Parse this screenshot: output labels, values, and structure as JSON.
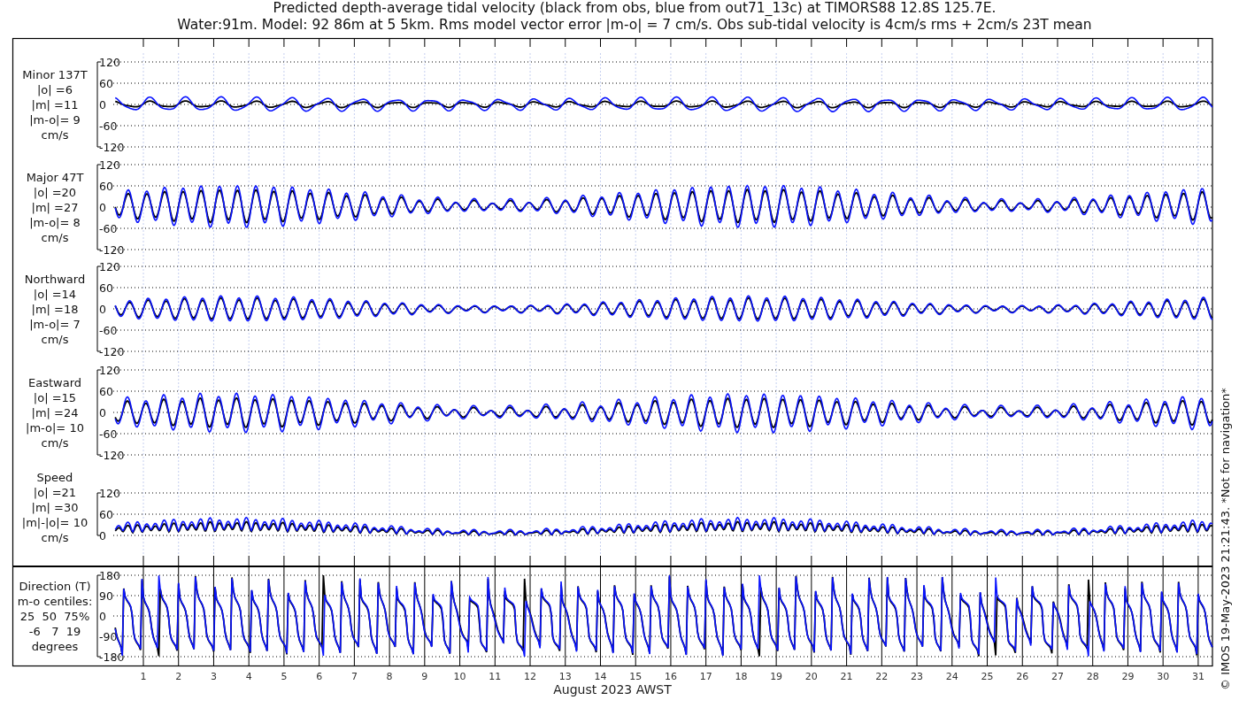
{
  "title_lines": [
    "Predicted depth-average tidal velocity (black from obs, blue from out71_13c) at TIMORS88 12.8S 125.7E.",
    "Water:91m. Model: 92 86m at 5 5km. Rms model vector error |m-o| = 7 cm/s. Obs sub-tidal velocity is 4cm/s rms + 2cm/s 23T mean"
  ],
  "panels": [
    {
      "kind": "minor",
      "label_lines": [
        "Minor 137T",
        "|o| =6",
        "|m| =11",
        "|m-o|= 9",
        "cm/s"
      ],
      "yticks": [
        "120",
        "60",
        "0",
        "-60",
        "-120"
      ]
    },
    {
      "kind": "major",
      "label_lines": [
        "Major 47T",
        "|o| =20",
        "|m| =27",
        "|m-o|= 8",
        "cm/s"
      ],
      "yticks": [
        "120",
        "60",
        "0",
        "-60",
        "-120"
      ]
    },
    {
      "kind": "north",
      "label_lines": [
        "Northward",
        "|o| =14",
        "|m| =18",
        "|m-o|= 7",
        "cm/s"
      ],
      "yticks": [
        "120",
        "60",
        "0",
        "-60",
        "-120"
      ]
    },
    {
      "kind": "east",
      "label_lines": [
        "Eastward",
        "|o| =15",
        "|m| =24",
        "|m-o|= 10",
        "cm/s"
      ],
      "yticks": [
        "120",
        "60",
        "0",
        "-60",
        "-120"
      ]
    },
    {
      "kind": "speed",
      "label_lines": [
        "Speed",
        "|o| =21",
        "|m| =30",
        "|m|-|o|= 10",
        "cm/s"
      ],
      "yticks": [
        "120",
        "60",
        "0"
      ]
    },
    {
      "kind": "direction",
      "label_lines": [
        "Direction (T)",
        "m-o centiles:",
        "25  50  75%",
        "-6   7  19",
        "degrees"
      ],
      "yticks": [
        "180",
        "90",
        "0",
        "-90",
        "-180"
      ]
    }
  ],
  "x_tick_labels": [
    "1",
    "2",
    "3",
    "4",
    "5",
    "6",
    "7",
    "8",
    "9",
    "10",
    "11",
    "12",
    "13",
    "14",
    "15",
    "16",
    "17",
    "18",
    "19",
    "20",
    "21",
    "22",
    "23",
    "24",
    "25",
    "26",
    "27",
    "28",
    "29",
    "30",
    "31"
  ],
  "xlabel": "August 2023 AWST",
  "side_note": "© IMOS 19-May-2023 21:21:43.  *Not for navigation*"
}
